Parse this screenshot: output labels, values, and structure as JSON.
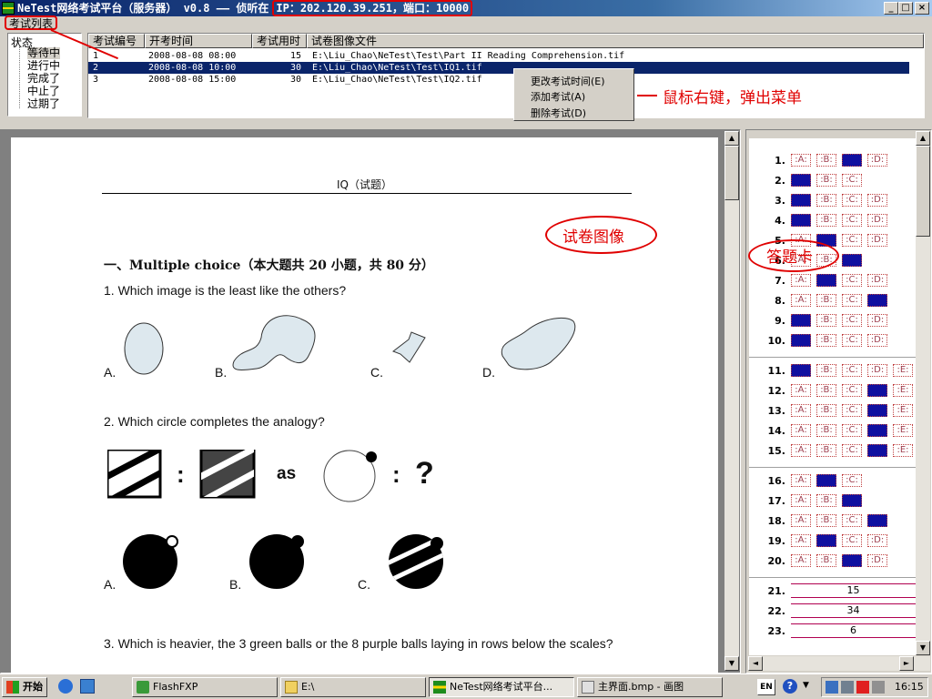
{
  "window": {
    "title_prefix": "NeTest网络考试平台（服务器） v0.8 —— 侦听在",
    "ip_text": "IP：202.120.39.251，端口：10000"
  },
  "menu": {
    "exam_list": "考试列表"
  },
  "status_tree": {
    "header": "状态",
    "items": [
      "等待中",
      "进行中",
      "完成了",
      "中止了",
      "过期了"
    ]
  },
  "exam_list": {
    "columns": [
      "考试编号",
      "开考时间",
      "考试用时",
      "试卷图像文件"
    ],
    "rows": [
      {
        "id": "1",
        "start": "2008-08-08 08:00",
        "duration": "15",
        "file": "E:\\Liu_Chao\\NeTest\\Test\\Part II Reading Comprehension.tif"
      },
      {
        "id": "2",
        "start": "2008-08-08 10:00",
        "duration": "30",
        "file": "E:\\Liu_Chao\\NeTest\\Test\\IQ1.tif"
      },
      {
        "id": "3",
        "start": "2008-08-08 15:00",
        "duration": "30",
        "file": "E:\\Liu_Chao\\NeTest\\Test\\IQ2.tif"
      }
    ]
  },
  "context_menu": {
    "items": [
      "更改考试时间(E)",
      "添加考试(A)",
      "删除考试(D)"
    ]
  },
  "annotations": {
    "right_click": "鼠标右键，弹出菜单",
    "paper_image": "试卷图像",
    "answer_card": "答题卡"
  },
  "paper": {
    "title": "IQ（试题）",
    "section": "一、Multiple choice（本大题共 20 小题，共 80 分）",
    "q1": "1. Which image is the least like the others?",
    "q2": "2. Which circle completes the analogy?",
    "q3": "3. Which is heavier, the 3 green balls or the 8 purple balls laying in rows below the scales?",
    "options": [
      "A.",
      "B.",
      "C.",
      "D."
    ],
    "as": "as",
    "colon": ":",
    "question_mark": "?"
  },
  "answer_card": {
    "mc": [
      {
        "n": "1.",
        "opts": [
          "A",
          "B",
          "C",
          "D"
        ],
        "sel": [
          2
        ]
      },
      {
        "n": "2.",
        "opts": [
          "A",
          "B",
          "C"
        ],
        "sel": [
          0
        ]
      },
      {
        "n": "3.",
        "opts": [
          "A",
          "B",
          "C",
          "D"
        ],
        "sel": [
          0
        ]
      },
      {
        "n": "4.",
        "opts": [
          "A",
          "B",
          "C",
          "D"
        ],
        "sel": [
          0
        ]
      },
      {
        "n": "5.",
        "opts": [
          "A",
          "B",
          "C",
          "D"
        ],
        "sel": [
          1
        ]
      },
      {
        "n": "6.",
        "opts": [
          "A",
          "B",
          "C"
        ],
        "sel": [
          2
        ]
      },
      {
        "n": "7.",
        "opts": [
          "A",
          "B",
          "C",
          "D"
        ],
        "sel": [
          1
        ]
      },
      {
        "n": "8.",
        "opts": [
          "A",
          "B",
          "C",
          "D"
        ],
        "sel": [
          3
        ]
      },
      {
        "n": "9.",
        "opts": [
          "A",
          "B",
          "C",
          "D"
        ],
        "sel": [
          0
        ]
      },
      {
        "n": "10.",
        "opts": [
          "A",
          "B",
          "C",
          "D"
        ],
        "sel": [
          0
        ]
      },
      {
        "n": "11.",
        "opts": [
          "A",
          "B",
          "C",
          "D",
          "E"
        ],
        "sel": [
          0
        ]
      },
      {
        "n": "12.",
        "opts": [
          "A",
          "B",
          "C",
          "D",
          "E"
        ],
        "sel": [
          3
        ]
      },
      {
        "n": "13.",
        "opts": [
          "A",
          "B",
          "C",
          "D",
          "E"
        ],
        "sel": [
          3
        ]
      },
      {
        "n": "14.",
        "opts": [
          "A",
          "B",
          "C",
          "D",
          "E"
        ],
        "sel": [
          3
        ]
      },
      {
        "n": "15.",
        "opts": [
          "A",
          "B",
          "C",
          "D",
          "E"
        ],
        "sel": [
          3
        ]
      },
      {
        "n": "16.",
        "opts": [
          "A",
          "B",
          "C"
        ],
        "sel": [
          1
        ]
      },
      {
        "n": "17.",
        "opts": [
          "A",
          "B",
          "C"
        ],
        "sel": [
          2
        ]
      },
      {
        "n": "18.",
        "opts": [
          "A",
          "B",
          "C",
          "D"
        ],
        "sel": [
          3
        ]
      },
      {
        "n": "19.",
        "opts": [
          "A",
          "B",
          "C",
          "D"
        ],
        "sel": [
          1
        ]
      },
      {
        "n": "20.",
        "opts": [
          "A",
          "B",
          "C",
          "D"
        ],
        "sel": [
          2
        ]
      }
    ],
    "fill": [
      {
        "n": "21.",
        "value": "15"
      },
      {
        "n": "22.",
        "value": "34"
      },
      {
        "n": "23.",
        "value": "6"
      }
    ]
  },
  "taskbar": {
    "start": "开始",
    "tasks": [
      "FlashFXP",
      "E:\\",
      "NeTest网络考试平台...",
      "主界面.bmp - 画图"
    ],
    "lang": "EN",
    "clock": "16:15"
  }
}
